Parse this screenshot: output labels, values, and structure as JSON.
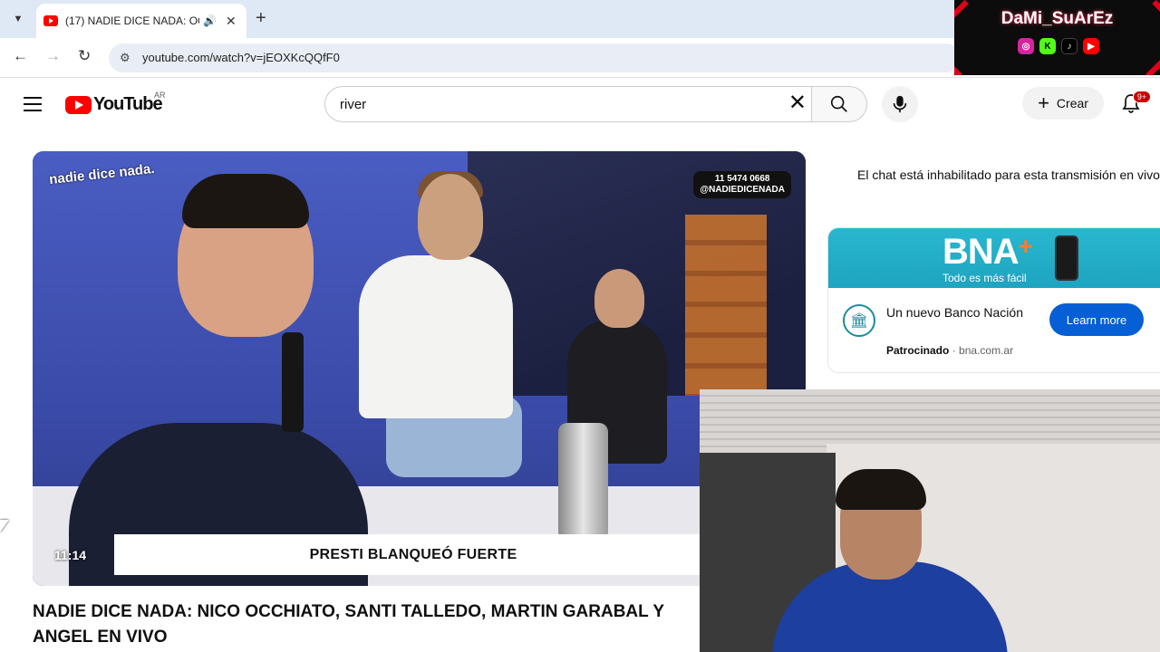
{
  "browser": {
    "tab_title": "(17) NADIE DICE NADA: OC",
    "url": "youtube.com/watch?v=jEOXKcQQfF0"
  },
  "header": {
    "logo_text": "YouTube",
    "region": "AR",
    "search_value": "river",
    "create_label": "Crear",
    "notification_count": "9+"
  },
  "player": {
    "show_logo": "nadie dice nada.",
    "show_phone": "11 5474 0668",
    "show_handle": "@NADIEDICENADA",
    "chyron": "PRESTI BLANQUEÓ FUERTE",
    "timestamp": "11:14"
  },
  "video": {
    "title": "NADIE DICE NADA: NICO OCCHIATO, SANTI TALLEDO, MARTIN GARABAL Y ANGEL EN VIVO"
  },
  "sidebar": {
    "chat_notice": "El chat está inhabilitado para esta transmisión en vivo"
  },
  "ad": {
    "brand": "BNA",
    "slogan": "Todo es más fácil",
    "title": "Un nuevo Banco Nación",
    "sponsored": "Patrocinado",
    "domain": "bna.com.ar",
    "cta": "Learn more"
  },
  "overlay": {
    "streamer_name": "DaMi_SuArEz"
  },
  "colors": {
    "youtube_red": "#ff0000",
    "cta_blue": "#065fd4",
    "badge_red": "#cc0000"
  }
}
